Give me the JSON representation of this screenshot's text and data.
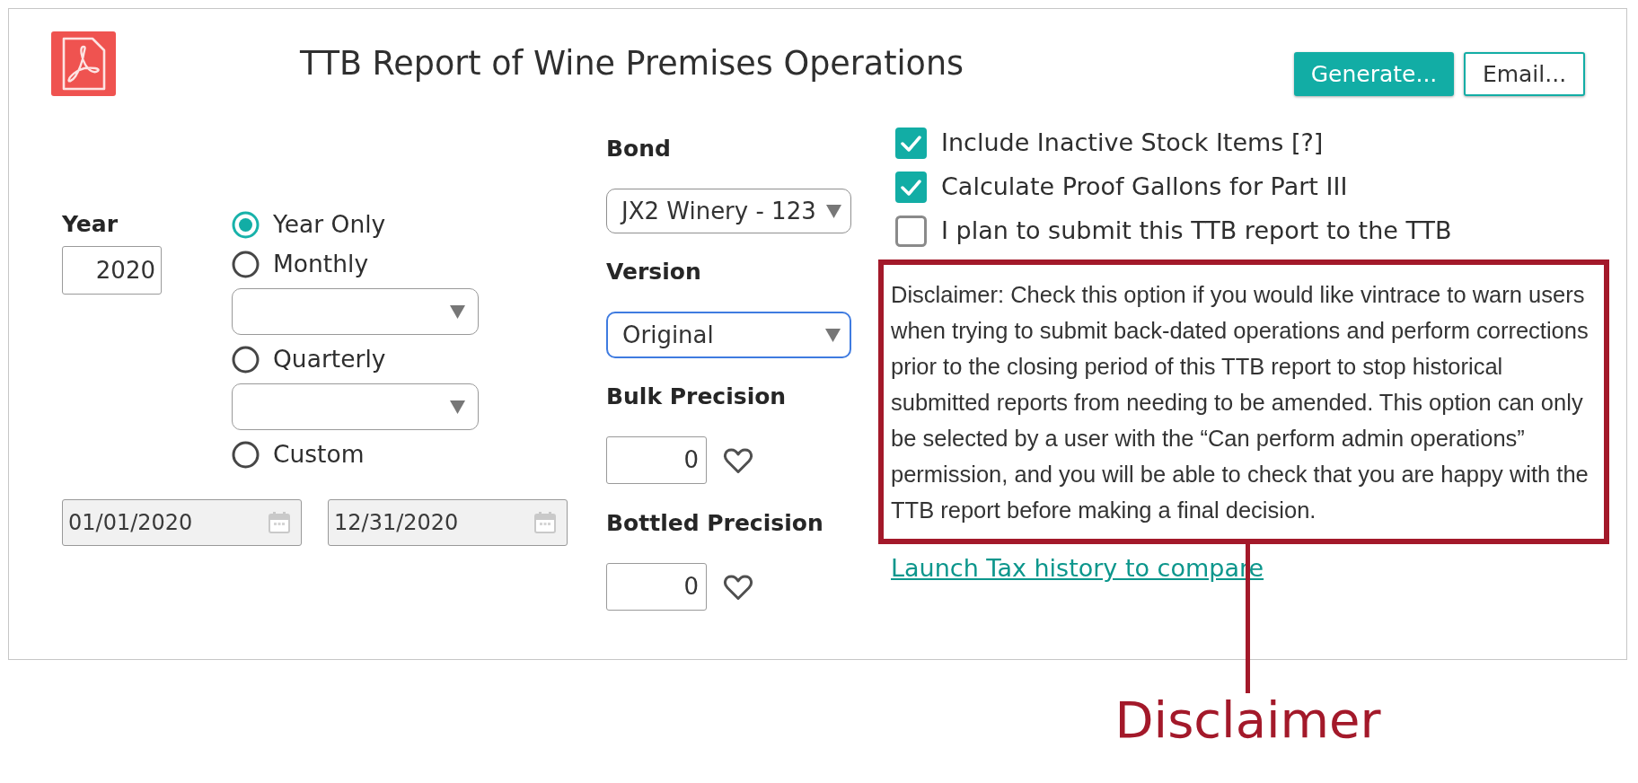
{
  "header": {
    "title": "TTB Report of Wine Premises Operations",
    "buttons": [
      {
        "label": "Generate...",
        "kind": "primary"
      },
      {
        "label": "Email...",
        "kind": "outline"
      }
    ]
  },
  "year": {
    "label": "Year",
    "value": "2020"
  },
  "period_options": [
    {
      "label": "Year Only",
      "selected": true,
      "has_dropdown": false
    },
    {
      "label": "Monthly",
      "selected": false,
      "has_dropdown": true
    },
    {
      "label": "Quarterly",
      "selected": false,
      "has_dropdown": true
    },
    {
      "label": "Custom",
      "selected": false,
      "has_dropdown": false
    }
  ],
  "date_range": [
    {
      "value": "01/01/2020",
      "disabled": true
    },
    {
      "value": "12/31/2020",
      "disabled": true
    }
  ],
  "settings": [
    {
      "kind": "select",
      "label": "Bond",
      "value": "JX2 Winery - 123",
      "focused": false
    },
    {
      "kind": "select",
      "label": "Version",
      "value": "Original",
      "focused": true
    },
    {
      "kind": "number",
      "label": "Bulk Precision",
      "value": "0"
    },
    {
      "kind": "number",
      "label": "Bottled Precision",
      "value": "0"
    }
  ],
  "options": [
    {
      "label": "Include Inactive Stock Items [?]",
      "checked": true
    },
    {
      "label": "Calculate Proof Gallons for Part III",
      "checked": true
    },
    {
      "label": "I plan to submit this TTB report to the TTB",
      "checked": false
    }
  ],
  "disclaimer": {
    "text": "Disclaimer: Check this option if you would like vintrace to warn users when trying to submit back-dated operations and perform corrections prior to the closing period of this TTB report to stop historical submitted reports from needing to be amended. This option can only be selected by a user with the “Can perform admin operations” permission, and you will be able to check that you are happy with the TTB report before making a final decision.",
    "highlighted": true
  },
  "link": {
    "label": "Launch Tax history to compare"
  },
  "annotation": {
    "label": "Disclaimer"
  }
}
